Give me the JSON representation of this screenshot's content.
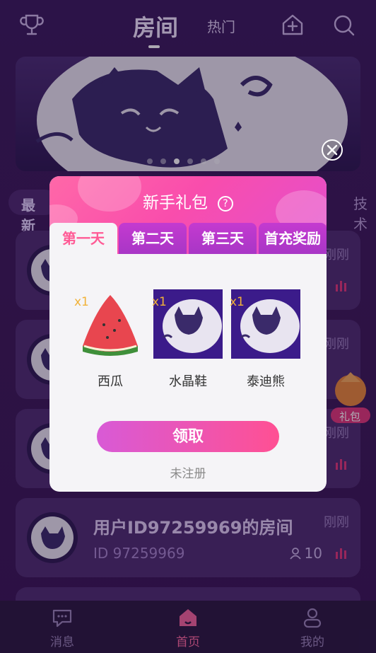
{
  "header": {
    "tab_room": "房间",
    "tab_hot": "热门"
  },
  "banner": {
    "slide_count": 6,
    "active_index": 2
  },
  "categories": {
    "left": "最新",
    "right": "技术"
  },
  "rooms": [
    {
      "title": "",
      "id_text": "",
      "time": "刚刚",
      "users": ""
    },
    {
      "title": "",
      "id_text": "",
      "time": "刚刚",
      "users": ""
    },
    {
      "title": "",
      "id_text": "",
      "time": "刚刚",
      "users": ""
    },
    {
      "title": "用户ID97259969的房间",
      "id_text": "ID 97259969",
      "time": "刚刚",
      "users": "10"
    }
  ],
  "bottom_nav": {
    "messages": "消息",
    "home": "首页",
    "mine": "我的"
  },
  "gift_float": {
    "label": "礼包"
  },
  "modal": {
    "title": "新手礼包",
    "help": "?",
    "tabs": [
      "第一天",
      "第二天",
      "第三天",
      "首充奖励"
    ],
    "active_tab": 0,
    "gifts": [
      {
        "name": "西瓜",
        "count": "x1"
      },
      {
        "name": "水晶鞋",
        "count": "x1"
      },
      {
        "name": "泰迪熊",
        "count": "x1"
      }
    ],
    "claim_label": "领取",
    "status_text": "未注册"
  },
  "colors": {
    "accent_pink": "#ff5093",
    "accent_purple": "#c43ad0",
    "background": "#3a1a5c"
  }
}
